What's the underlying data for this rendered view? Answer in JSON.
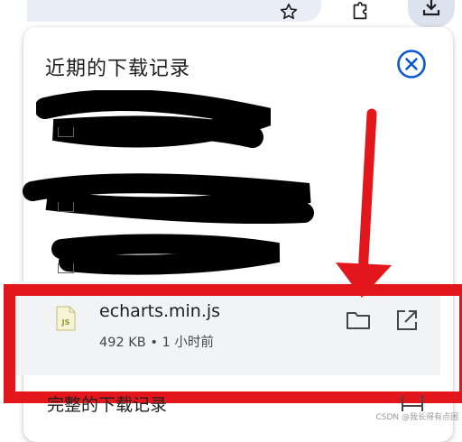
{
  "panel": {
    "title": "近期的下载记录",
    "footer_link": "完整的下载记录"
  },
  "item": {
    "file_name": "echarts.min.js",
    "file_meta": "492 KB • 1 小时前",
    "file_type_badge": "JS"
  },
  "icons": {
    "toolbar": [
      "star-icon",
      "extension-icon",
      "download-icon"
    ],
    "panel": [
      "close-icon",
      "folder-icon",
      "open-external-icon",
      "js-file-icon",
      "external-link-icon"
    ]
  },
  "colors": {
    "annotation_red": "#e3171b",
    "accent_blue": "#0b57d0",
    "row_bg": "#f1f3f4"
  },
  "watermark": "CSDN @我长得有点困"
}
